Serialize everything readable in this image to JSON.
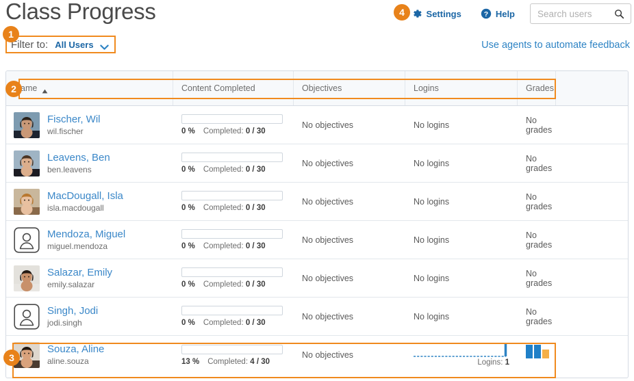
{
  "header": {
    "title": "Class Progress",
    "settings_label": "Settings",
    "help_label": "Help",
    "search_placeholder": "Search users",
    "search_value": ""
  },
  "filter": {
    "label": "Filter to:",
    "value": "All Users"
  },
  "agents_link": "Use agents to automate feedback",
  "badges": {
    "one": "1",
    "two": "2",
    "three": "3",
    "four": "4"
  },
  "table": {
    "columns": [
      {
        "key": "name",
        "label": "Name"
      },
      {
        "key": "content",
        "label": "Content Completed"
      },
      {
        "key": "obj",
        "label": "Objectives"
      },
      {
        "key": "logins",
        "label": "Logins"
      },
      {
        "key": "grades",
        "label": "Grades"
      }
    ],
    "sort": {
      "column": "Name",
      "direction": "ascending"
    },
    "rows": [
      {
        "name": "Fischer, Wil",
        "username": "wil.fischer",
        "avatar": "photo-male-1",
        "percent": "0 %",
        "percent_value": 0,
        "completed": "Completed:",
        "completed_value": "0 / 30",
        "objectives": "No objectives",
        "logins": "No logins",
        "grades": "No grades",
        "has_login_chart": false,
        "has_grade_chart": false
      },
      {
        "name": "Leavens, Ben",
        "username": "ben.leavens",
        "avatar": "photo-male-2",
        "percent": "0 %",
        "percent_value": 0,
        "completed": "Completed:",
        "completed_value": "0 / 30",
        "objectives": "No objectives",
        "logins": "No logins",
        "grades": "No grades",
        "has_login_chart": false,
        "has_grade_chart": false
      },
      {
        "name": "MacDougall, Isla",
        "username": "isla.macdougall",
        "avatar": "photo-female-1",
        "percent": "0 %",
        "percent_value": 0,
        "completed": "Completed:",
        "completed_value": "0 / 30",
        "objectives": "No objectives",
        "logins": "No logins",
        "grades": "No grades",
        "has_login_chart": false,
        "has_grade_chart": false
      },
      {
        "name": "Mendoza, Miguel",
        "username": "miguel.mendoza",
        "avatar": "placeholder",
        "percent": "0 %",
        "percent_value": 0,
        "completed": "Completed:",
        "completed_value": "0 / 30",
        "objectives": "No objectives",
        "logins": "No logins",
        "grades": "No grades",
        "has_login_chart": false,
        "has_grade_chart": false
      },
      {
        "name": "Salazar, Emily",
        "username": "emily.salazar",
        "avatar": "photo-female-2",
        "percent": "0 %",
        "percent_value": 0,
        "completed": "Completed:",
        "completed_value": "0 / 30",
        "objectives": "No objectives",
        "logins": "No logins",
        "grades": "No grades",
        "has_login_chart": false,
        "has_grade_chart": false
      },
      {
        "name": "Singh, Jodi",
        "username": "jodi.singh",
        "avatar": "placeholder",
        "percent": "0 %",
        "percent_value": 0,
        "completed": "Completed:",
        "completed_value": "0 / 30",
        "objectives": "No objectives",
        "logins": "No logins",
        "grades": "No grades",
        "has_login_chart": false,
        "has_grade_chart": false
      },
      {
        "name": "Souza, Aline",
        "username": "aline.souza",
        "avatar": "photo-female-3",
        "percent": "13 %",
        "percent_value": 13,
        "completed": "Completed:",
        "completed_value": "4 / 30",
        "objectives": "No objectives",
        "logins": "Logins: 1",
        "logins_count": "1",
        "grades": "",
        "has_login_chart": true,
        "has_grade_chart": true,
        "grade_bars": [
          20,
          20,
          13
        ]
      }
    ]
  },
  "colors": {
    "accent_orange": "#f08a1e",
    "link_blue": "#3a87c8",
    "bar_blue": "#2080c8",
    "bar_orange": "#f5b048",
    "header_bg": "#f7f9fb",
    "border": "#d5dbe3"
  }
}
